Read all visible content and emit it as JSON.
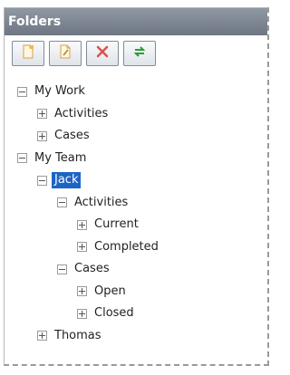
{
  "panel": {
    "title": "Folders"
  },
  "toolbar": {
    "buttons": [
      {
        "name": "new-folder",
        "icon": "new-folder-icon"
      },
      {
        "name": "rename-folder",
        "icon": "rename-folder-icon"
      },
      {
        "name": "delete-folder",
        "icon": "delete-icon"
      },
      {
        "name": "refresh",
        "icon": "refresh-icon"
      }
    ]
  },
  "tree": {
    "my_work": {
      "label": "My Work",
      "expanded": true
    },
    "my_work_activities": {
      "label": "Activities",
      "expanded": false
    },
    "my_work_cases": {
      "label": "Cases",
      "expanded": false
    },
    "my_team": {
      "label": "My Team",
      "expanded": true
    },
    "jack": {
      "label": "Jack",
      "expanded": true,
      "selected": true
    },
    "jack_activities": {
      "label": "Activities",
      "expanded": true
    },
    "jack_activities_current": {
      "label": "Current",
      "expanded": false
    },
    "jack_activities_completed": {
      "label": "Completed",
      "expanded": false
    },
    "jack_cases": {
      "label": "Cases",
      "expanded": true
    },
    "jack_cases_open": {
      "label": "Open",
      "expanded": false
    },
    "jack_cases_closed": {
      "label": "Closed",
      "expanded": false
    },
    "thomas": {
      "label": "Thomas",
      "expanded": false
    }
  },
  "colors": {
    "title_bar": "#7c8591",
    "selection": "#1c64c4",
    "delete_red": "#d9534f",
    "refresh_green": "#2e9c3a"
  }
}
